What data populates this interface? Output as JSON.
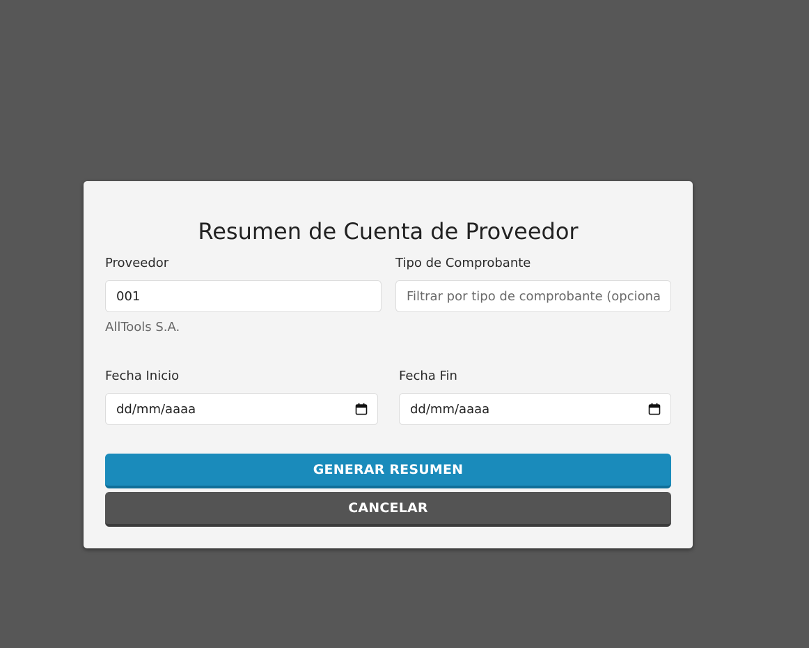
{
  "dialog": {
    "title": "Resumen de Cuenta de Proveedor",
    "proveedor": {
      "label": "Proveedor",
      "value": "001",
      "hint": "AllTools S.A."
    },
    "tipo_comprobante": {
      "label": "Tipo de Comprobante",
      "value": "",
      "placeholder": "Filtrar por tipo de comprobante (opcional)"
    },
    "fecha_inicio": {
      "label": "Fecha Inicio",
      "value": "dd/mm/aaaa"
    },
    "fecha_fin": {
      "label": "Fecha Fin",
      "value": "dd/mm/aaaa"
    },
    "generate_label": "GENERAR RESUMEN",
    "cancel_label": "CANCELAR"
  },
  "colors": {
    "backdrop": "#575757",
    "dialog_bg": "#f4f4f4",
    "primary": "#1a8bbb",
    "secondary": "#545454"
  },
  "icons": {
    "date_picker": "calendar-icon"
  }
}
